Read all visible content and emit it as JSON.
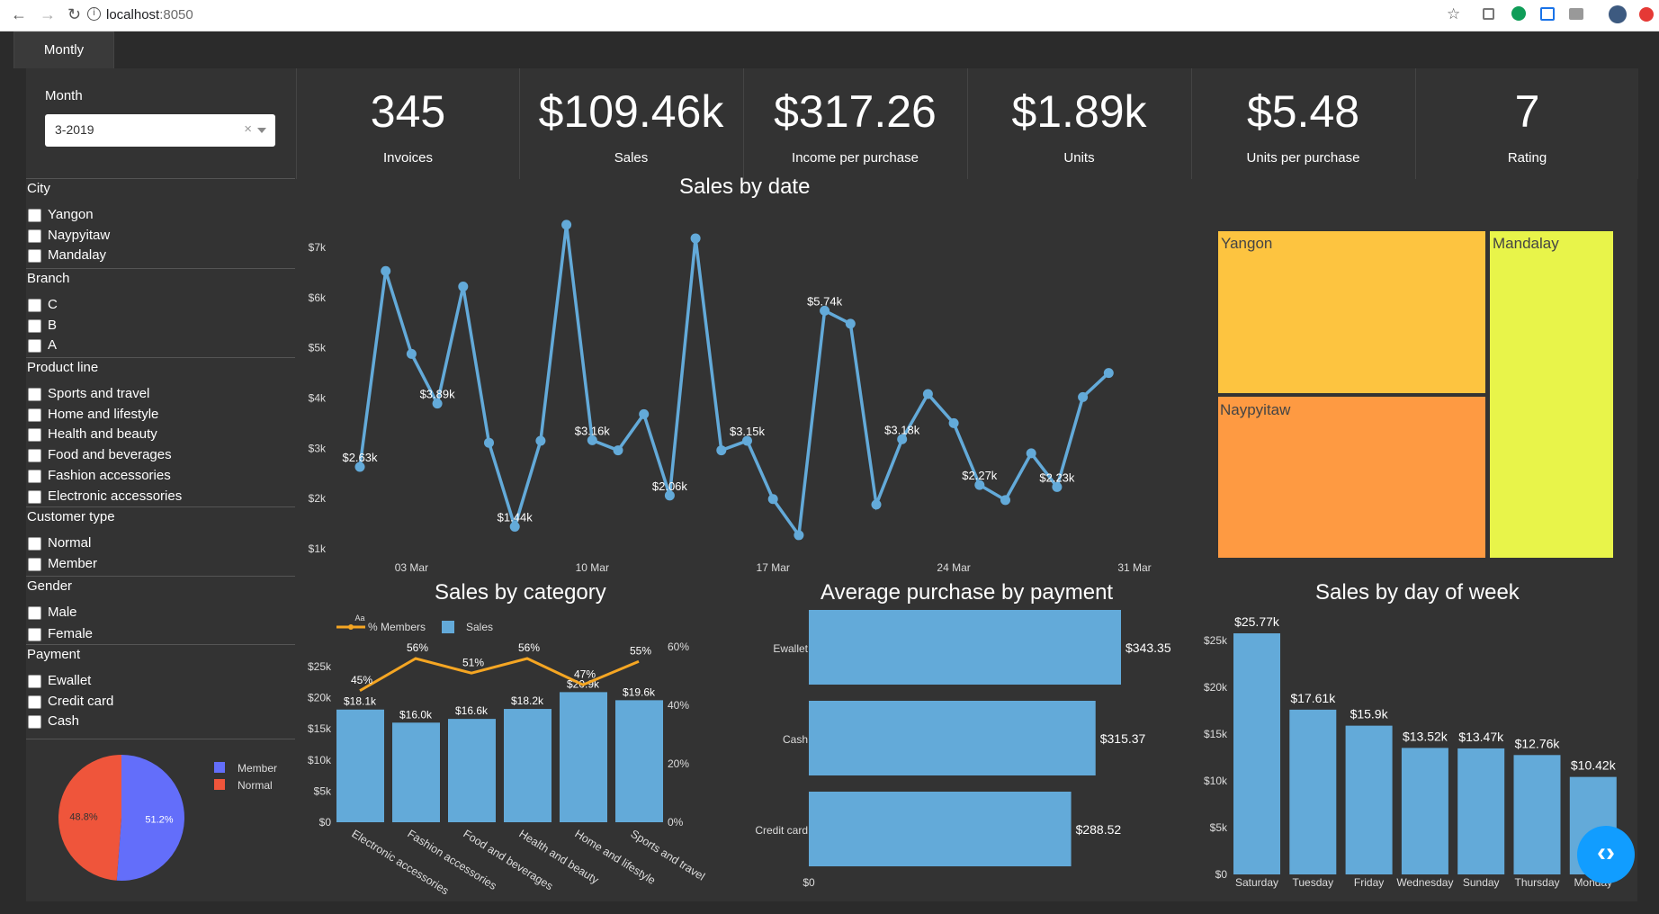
{
  "browser": {
    "url_host": "localhost",
    "url_port": ":8050"
  },
  "tab": {
    "label": "Montly"
  },
  "filters": {
    "month_label": "Month",
    "month_value": "3-2019",
    "clear_glyph": "×",
    "groups": [
      {
        "title": "City",
        "options": [
          "Yangon",
          "Naypyitaw",
          "Mandalay"
        ]
      },
      {
        "title": "Branch",
        "options": [
          "C",
          "B",
          "A"
        ]
      },
      {
        "title": "Product line",
        "options": [
          "Sports and travel",
          "Home and lifestyle",
          "Health and beauty",
          "Food and beverages",
          "Fashion accessories",
          "Electronic accessories"
        ]
      },
      {
        "title": "Customer type",
        "options": [
          "Normal",
          "Member"
        ]
      },
      {
        "title": "Gender",
        "options": [
          "Male",
          "Female"
        ]
      },
      {
        "title": "Payment",
        "options": [
          "Ewallet",
          "Credit card",
          "Cash"
        ]
      }
    ]
  },
  "kpis": [
    {
      "value": "345",
      "label": "Invoices"
    },
    {
      "value": "$109.46k",
      "label": "Sales"
    },
    {
      "value": "$317.26",
      "label": "Income per purchase"
    },
    {
      "value": "$1.89k",
      "label": "Units"
    },
    {
      "value": "$5.48",
      "label": "Units per purchase"
    },
    {
      "value": "7",
      "label": "Rating"
    }
  ],
  "titles": {
    "sales_by_date": "Sales by date",
    "sales_by_category": "Sales by category",
    "avg_by_payment": "Average purchase by payment",
    "sales_by_dow": "Sales by day of week"
  },
  "colors": {
    "bar": "#63aad9",
    "line_orange": "#f5a623",
    "member": "#636efa",
    "normal": "#ef553b",
    "yangon": "#fdc440",
    "naypyitaw": "#fe9a42",
    "mandalay": "#e8f44a"
  },
  "chart_data": [
    {
      "type": "line",
      "title": "Sales by date",
      "x": [
        "2019-03-01",
        "2019-03-02",
        "2019-03-03",
        "2019-03-04",
        "2019-03-05",
        "2019-03-06",
        "2019-03-07",
        "2019-03-08",
        "2019-03-09",
        "2019-03-10",
        "2019-03-11",
        "2019-03-12",
        "2019-03-13",
        "2019-03-14",
        "2019-03-15",
        "2019-03-16",
        "2019-03-17",
        "2019-03-18",
        "2019-03-19",
        "2019-03-20",
        "2019-03-21",
        "2019-03-22",
        "2019-03-23",
        "2019-03-24",
        "2019-03-25",
        "2019-03-26",
        "2019-03-27",
        "2019-03-28",
        "2019-03-29",
        "2019-03-30"
      ],
      "values": [
        2630,
        6530,
        4880,
        3890,
        6220,
        3110,
        1440,
        3150,
        7450,
        3160,
        2960,
        3680,
        2060,
        7180,
        2960,
        3150,
        1990,
        1270,
        5740,
        5480,
        1880,
        3180,
        4080,
        3500,
        2270,
        1970,
        2900,
        2230,
        4020,
        4500
      ],
      "labels": {
        "0": "$2.63k",
        "3": "$3.89k",
        "6": "$1.44k",
        "9": "$3.16k",
        "12": "$2.06k",
        "15": "$3.15k",
        "18": "$5.74k",
        "21": "$3.18k",
        "24": "$2.27k",
        "27": "$2.23k"
      },
      "yticks": [
        "$1k",
        "$2k",
        "$3k",
        "$4k",
        "$5k",
        "$6k",
        "$7k"
      ],
      "xticks": [
        "03 Mar",
        "10 Mar",
        "17 Mar",
        "24 Mar",
        "31 Mar"
      ],
      "ylim": [
        800,
        7700
      ]
    },
    {
      "type": "treemap",
      "labels": [
        "Yangon",
        "Naypyitaw",
        "Mandalay"
      ],
      "values": [
        38.6,
        38.2,
        32.6
      ]
    },
    {
      "type": "bar",
      "title": "Sales by category",
      "categories": [
        "Electronic accessories",
        "Fashion accessories",
        "Food and beverages",
        "Health and beauty",
        "Home and lifestyle",
        "Sports and travel"
      ],
      "series": [
        {
          "name": "Sales",
          "values": [
            18100,
            16000,
            16600,
            18200,
            20900,
            19600
          ],
          "labels": [
            "$18.1k",
            "$16.0k",
            "$16.6k",
            "$18.2k",
            "$20.9k",
            "$19.6k"
          ]
        },
        {
          "name": "% Members",
          "values": [
            45,
            56,
            51,
            56,
            47,
            55
          ],
          "labels": [
            "45%",
            "56%",
            "51%",
            "56%",
            "47%",
            "55%"
          ]
        }
      ],
      "yticks": [
        "$0",
        "$5k",
        "$10k",
        "$15k",
        "$20k",
        "$25k"
      ],
      "y2ticks": [
        "0%",
        "20%",
        "40%",
        "60%"
      ],
      "legend_glyph": "Aa",
      "ylim": [
        0,
        25000
      ],
      "y2lim": [
        0,
        60
      ]
    },
    {
      "type": "bar",
      "title": "Average purchase by payment",
      "orientation": "horizontal",
      "categories": [
        "Ewallet",
        "Cash",
        "Credit card"
      ],
      "values": [
        343.35,
        315.37,
        288.52
      ],
      "labels": [
        "$343.35",
        "$315.37",
        "$288.52"
      ],
      "xticks": [
        "$0"
      ],
      "xlim": [
        0,
        350
      ]
    },
    {
      "type": "bar",
      "title": "Sales by day of week",
      "categories": [
        "Saturday",
        "Tuesday",
        "Friday",
        "Wednesday",
        "Sunday",
        "Thursday",
        "Monday"
      ],
      "values": [
        25770,
        17610,
        15900,
        13520,
        13470,
        12760,
        10420
      ],
      "labels": [
        "$25.77k",
        "$17.61k",
        "$15.9k",
        "$13.52k",
        "$13.47k",
        "$12.76k",
        "$10.42k"
      ],
      "yticks": [
        "$0",
        "$5k",
        "$10k",
        "$15k",
        "$20k",
        "$25k"
      ],
      "ylim": [
        0,
        27500
      ]
    },
    {
      "type": "pie",
      "categories": [
        "Member",
        "Normal"
      ],
      "values": [
        51.2,
        48.8
      ],
      "labels": [
        "51.2%",
        "48.8%"
      ]
    }
  ]
}
